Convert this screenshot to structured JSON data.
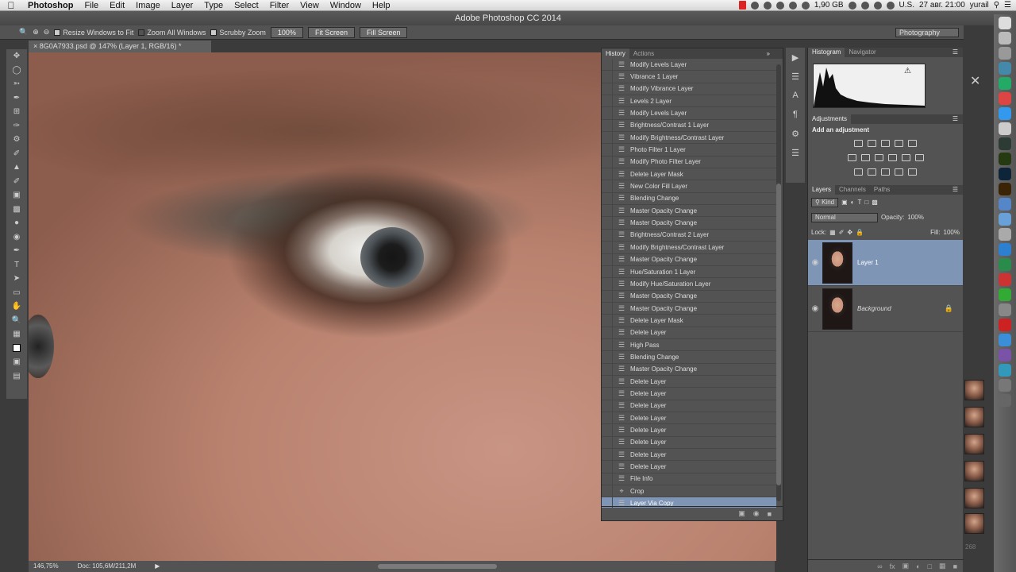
{
  "menubar": {
    "apple": "",
    "app": "Photoshop",
    "items": [
      "File",
      "Edit",
      "Image",
      "Layer",
      "Type",
      "Select",
      "Filter",
      "View",
      "Window",
      "Help"
    ],
    "right": {
      "memory": "1,90 GB",
      "locale": "U.S.",
      "datetime": "27 авг. 21:00",
      "user": "yurail"
    }
  },
  "window": {
    "title": "Adobe Photoshop CC 2014"
  },
  "options": {
    "resize": "Resize Windows to Fit",
    "zoom_all": "Zoom All Windows",
    "scrubby": "Scrubby Zoom",
    "zoom100": "100%",
    "fit_screen": "Fit Screen",
    "fill_screen": "Fill Screen",
    "workspace": "Photography"
  },
  "document": {
    "tab": "8G0A7933.psd @ 147% (Layer 1, RGB/16) *"
  },
  "status": {
    "zoom": "146,75%",
    "doc": "Doc: 105,6M/211,2M"
  },
  "history": {
    "tabs": [
      "History",
      "Actions"
    ],
    "items": [
      "Modify Levels Layer",
      "Vibrance 1 Layer",
      "Modify Vibrance Layer",
      "Levels 2 Layer",
      "Modify Levels Layer",
      "Brightness/Contrast 1 Layer",
      "Modify Brightness/Contrast Layer",
      "Photo Filter 1 Layer",
      "Modify Photo Filter Layer",
      "Delete Layer Mask",
      "New Color Fill Layer",
      "Blending Change",
      "Master Opacity Change",
      "Master Opacity Change",
      "Brightness/Contrast 2 Layer",
      "Modify Brightness/Contrast Layer",
      "Master Opacity Change",
      "Hue/Saturation 1 Layer",
      "Modify Hue/Saturation Layer",
      "Master Opacity Change",
      "Master Opacity Change",
      "Delete Layer Mask",
      "Delete Layer",
      "High Pass",
      "Blending Change",
      "Master Opacity Change",
      "Delete Layer",
      "Delete Layer",
      "Delete Layer",
      "Delete Layer",
      "Delete Layer",
      "Delete Layer",
      "Delete Layer",
      "Delete Layer",
      "File Info",
      "Crop",
      "Layer Via Copy"
    ],
    "selected": "Layer Via Copy"
  },
  "histogram": {
    "tabs": [
      "Histogram",
      "Navigator"
    ]
  },
  "adjustments": {
    "tab": "Adjustments",
    "label": "Add an adjustment"
  },
  "layers": {
    "tabs": [
      "Layers",
      "Channels",
      "Paths"
    ],
    "kind": "Kind",
    "blend": "Normal",
    "opacity_label": "Opacity:",
    "opacity": "100%",
    "lock_label": "Lock:",
    "fill_label": "Fill:",
    "fill": "100%",
    "items": [
      {
        "name": "Layer 1",
        "selected": true
      },
      {
        "name": "Background",
        "selected": false
      }
    ]
  },
  "badge": "268",
  "colors": {
    "accent": "#7f95b6",
    "panel": "#535353",
    "dark": "#3b3b3b"
  }
}
